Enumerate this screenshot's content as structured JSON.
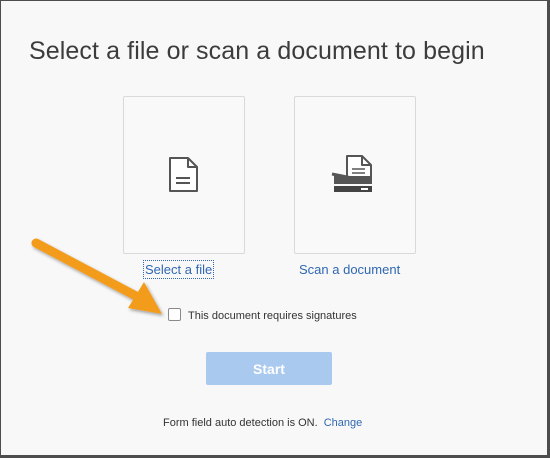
{
  "header": {
    "title": "Select a file or scan a document to begin"
  },
  "options": {
    "select_file": {
      "label": "Select a file",
      "icon": "document-icon"
    },
    "scan_document": {
      "label": "Scan a document",
      "icon": "scanner-icon"
    }
  },
  "signature": {
    "label": "This document requires signatures",
    "checked": false
  },
  "actions": {
    "start_label": "Start"
  },
  "footer": {
    "status": "Form field auto detection is ON.",
    "change_label": "Change"
  },
  "colors": {
    "link": "#2f67b2",
    "start_button_disabled": "#a9c9ef",
    "annotation_arrow": "#f39c1f"
  }
}
